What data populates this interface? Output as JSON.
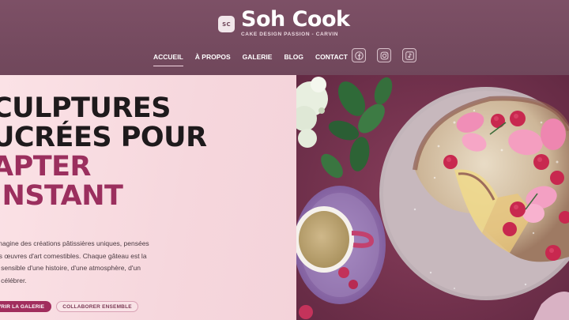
{
  "brand": {
    "logo_text": "SC",
    "name": "Soh Cook",
    "tagline": "CAKE DESIGN PASSION - CARVIN"
  },
  "nav": {
    "items": [
      {
        "label": "ACCUEIL",
        "active": true
      },
      {
        "label": "À PROPOS",
        "active": false
      },
      {
        "label": "GALERIE",
        "active": false
      },
      {
        "label": "BLOG",
        "active": false
      },
      {
        "label": "CONTACT",
        "active": false
      }
    ]
  },
  "socials": [
    {
      "icon": "facebook-icon"
    },
    {
      "icon": "instagram-icon"
    },
    {
      "icon": "tiktok-icon"
    }
  ],
  "hero": {
    "headline_line1": "CULPTURES",
    "headline_line2": "UCRÉES POUR",
    "headline_line3": "APTER",
    "headline_line4": "INSTANT",
    "description_line1": "imagine des créations pâtissières uniques, pensées",
    "description_line2": "es œuvres d'art comestibles. Chaque gâteau est la",
    "description_line3": "n sensible d'une histoire, d'une atmosphère, d'un",
    "description_line4": "à célébrer.",
    "primary_button": "VRIR LA GALERIE",
    "secondary_button": "COLLABORER ENSEMBLE"
  },
  "colors": {
    "header_bg": "#70475b",
    "hero_bg": "#f6d7dd",
    "accent": "#9b2f5e",
    "button_primary": "#a12d5d"
  }
}
